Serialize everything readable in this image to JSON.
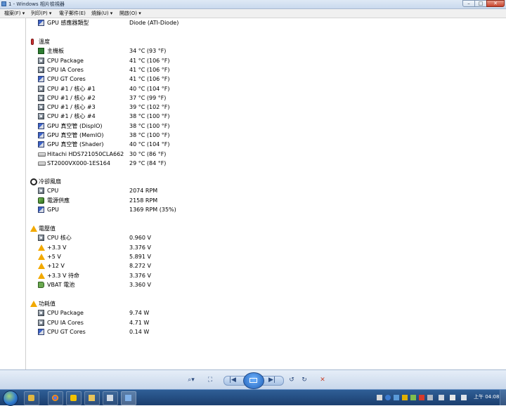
{
  "window": {
    "title": "1 - Windows 相片檢視器",
    "minimize": "–",
    "maximize": "□",
    "close": "✕"
  },
  "menu": [
    "檔案(F) ▾",
    "列印(P) ▾",
    "電子郵件(E)",
    "燒錄(U) ▾",
    "開啟(O) ▾"
  ],
  "content": {
    "top_row": {
      "label": "GPU 感應器類型",
      "value": "Diode  (ATI-Diode)"
    },
    "sections": [
      {
        "title": "溫度",
        "icon": "thermometer-icon",
        "rows": [
          {
            "label": "主機板",
            "value": "34 °C  (93 °F)",
            "icon": "motherboard-icon"
          },
          {
            "label": "CPU Package",
            "value": "41 °C  (106 °F)",
            "icon": "cpu-icon"
          },
          {
            "label": "CPU IA Cores",
            "value": "41 °C  (106 °F)",
            "icon": "cpu-icon"
          },
          {
            "label": "CPU GT Cores",
            "value": "41 °C  (106 °F)",
            "icon": "gpu-icon"
          },
          {
            "label": "CPU #1 / 核心 #1",
            "value": "40 °C  (104 °F)",
            "icon": "cpu-icon"
          },
          {
            "label": "CPU #1 / 核心 #2",
            "value": "37 °C  (99 °F)",
            "icon": "cpu-icon"
          },
          {
            "label": "CPU #1 / 核心 #3",
            "value": "39 °C  (102 °F)",
            "icon": "cpu-icon"
          },
          {
            "label": "CPU #1 / 核心 #4",
            "value": "38 °C  (100 °F)",
            "icon": "cpu-icon"
          },
          {
            "label": "GPU 真空管 (DispIO)",
            "value": "38 °C  (100 °F)",
            "icon": "gpu-icon"
          },
          {
            "label": "GPU 真空管 (MemIO)",
            "value": "38 °C  (100 °F)",
            "icon": "gpu-icon"
          },
          {
            "label": "GPU 真空管 (Shader)",
            "value": "40 °C  (104 °F)",
            "icon": "gpu-icon"
          },
          {
            "label": "Hitachi HDS721050CLA662",
            "value": "30 °C  (86 °F)",
            "icon": "hard-drive-icon"
          },
          {
            "label": "ST2000VX000-1ES164",
            "value": "29 °C  (84 °F)",
            "icon": "hard-drive-icon"
          }
        ]
      },
      {
        "title": "冷卻風扇",
        "icon": "fan-icon",
        "rows": [
          {
            "label": "CPU",
            "value": "2074 RPM",
            "icon": "cpu-icon"
          },
          {
            "label": "電源供應",
            "value": "2158 RPM",
            "icon": "power-supply-icon"
          },
          {
            "label": "GPU",
            "value": "1369 RPM  (35%)",
            "icon": "gpu-icon"
          }
        ]
      },
      {
        "title": "電壓值",
        "icon": "warning-icon",
        "rows": [
          {
            "label": "CPU 核心",
            "value": "0.960 V",
            "icon": "cpu-icon"
          },
          {
            "label": "+3.3 V",
            "value": "3.376 V",
            "icon": "warning-icon"
          },
          {
            "label": "+5 V",
            "value": "5.891 V",
            "icon": "warning-icon"
          },
          {
            "label": "+12 V",
            "value": "8.272 V",
            "icon": "warning-icon"
          },
          {
            "label": "+3.3 V 待命",
            "value": "3.376 V",
            "icon": "warning-icon"
          },
          {
            "label": "VBAT 電池",
            "value": "3.360 V",
            "icon": "battery-icon"
          }
        ]
      },
      {
        "title": "功耗值",
        "icon": "warning-icon",
        "rows": [
          {
            "label": "CPU Package",
            "value": "9.74 W",
            "icon": "cpu-icon"
          },
          {
            "label": "CPU IA Cores",
            "value": "4.71 W",
            "icon": "cpu-icon"
          },
          {
            "label": "CPU GT Cores",
            "value": "0.14 W",
            "icon": "gpu-icon"
          }
        ]
      }
    ]
  },
  "viewer_toolbar": {
    "zoom": "⌕▾",
    "fit": "⛶",
    "prev": "|◀",
    "next": "▶|",
    "rotate_ccw": "↺",
    "rotate_cw": "↻",
    "delete": "✕"
  },
  "taskbar": {
    "clock": "上午 04:08"
  },
  "colors": {
    "taskbar": "#1b3e6e",
    "viewer_bar": "#c7d6ea",
    "warning": "#f2a900",
    "close_button": "#c8432c"
  }
}
